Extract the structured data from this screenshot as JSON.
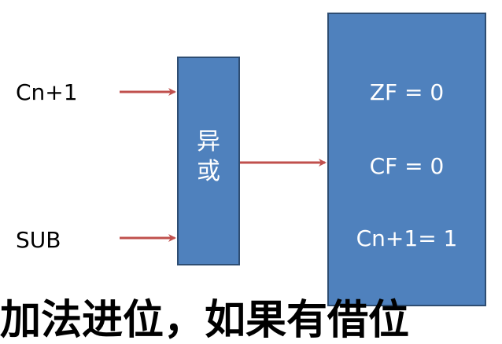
{
  "inputs": {
    "carry": "Cn+1",
    "sub": "SUB"
  },
  "xor_block": {
    "line1": "异",
    "line2": "或"
  },
  "flags": [
    "ZF = 0",
    "CF = 0",
    "Cn+1= 1"
  ],
  "caption": "加法进位，如果有借位",
  "colors": {
    "block_fill": "#4f81bd",
    "block_border": "#2e4d72",
    "arrow": "#c0504d"
  }
}
